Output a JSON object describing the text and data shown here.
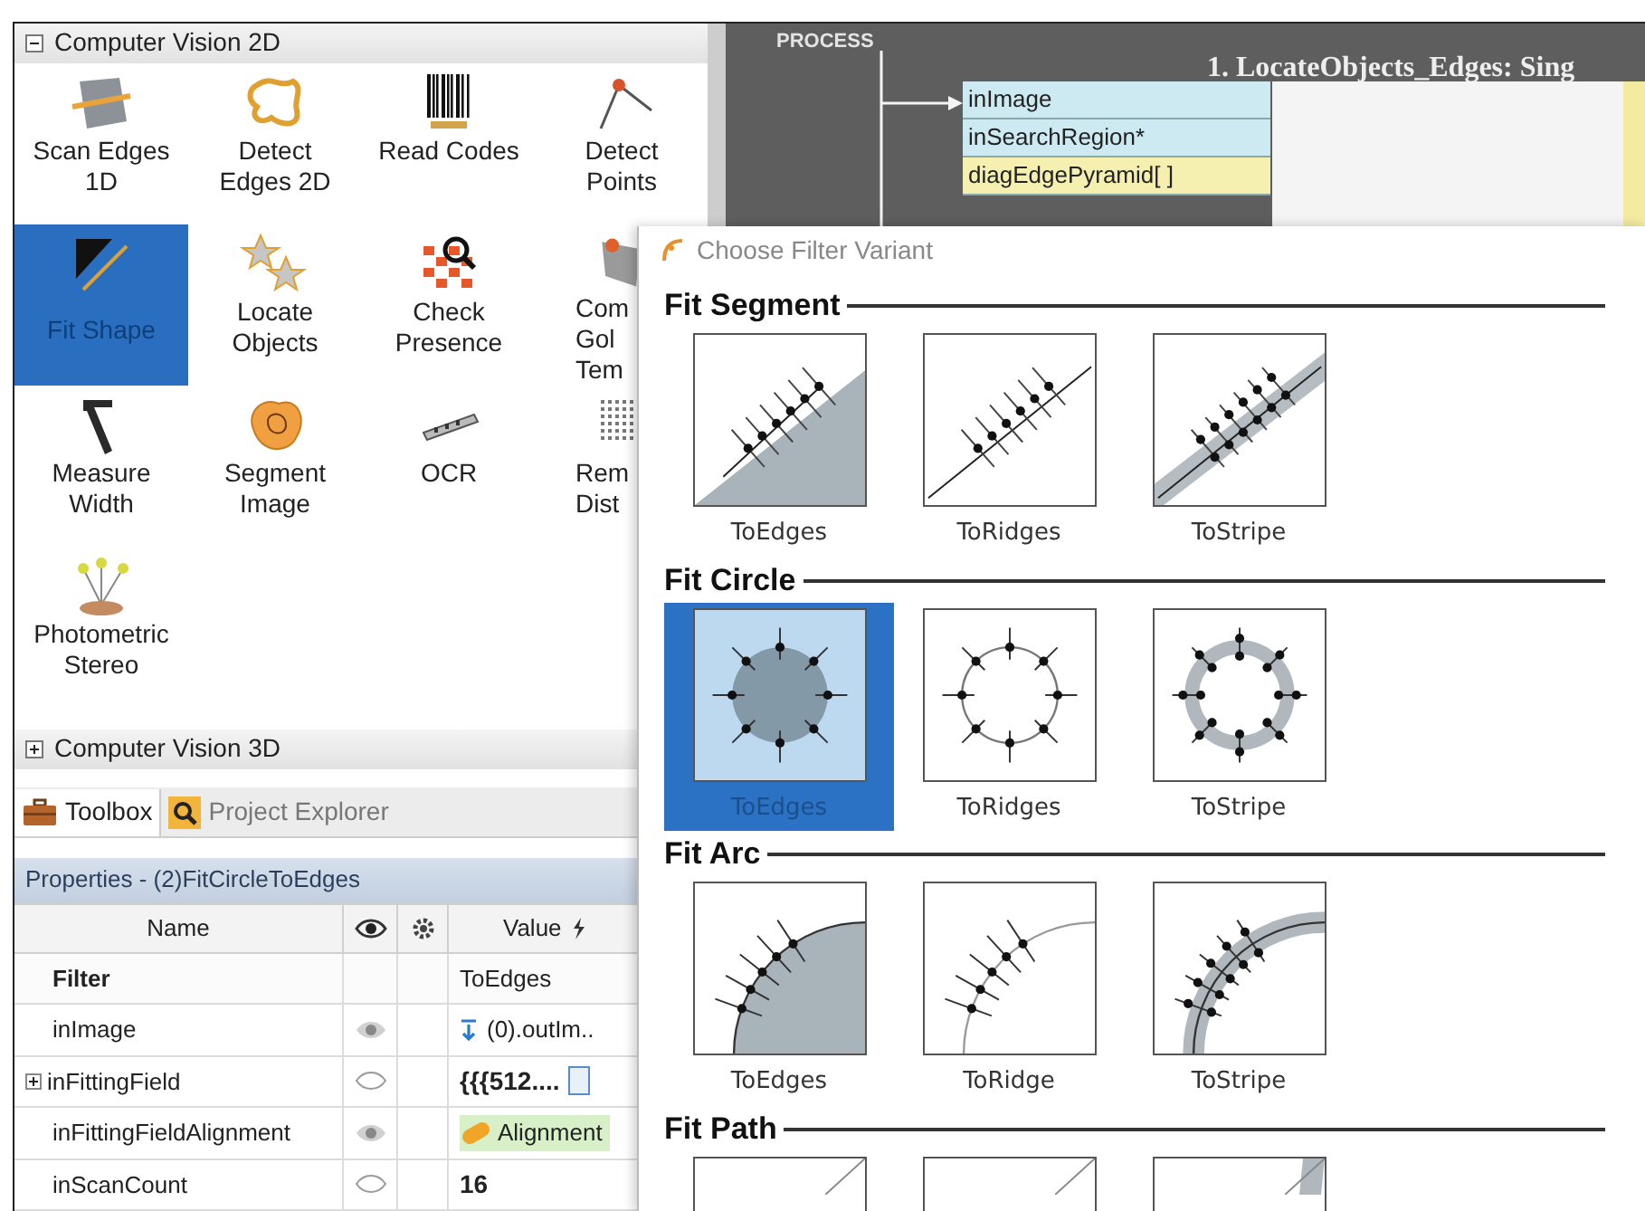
{
  "toolbox": {
    "groups": [
      {
        "label": "Computer Vision 2D",
        "expanded": true
      },
      {
        "label": "Computer Vision 3D",
        "expanded": false
      }
    ],
    "tools": [
      {
        "lines": [
          "Scan Edges",
          "1D"
        ],
        "selected": false
      },
      {
        "lines": [
          "Detect",
          "Edges 2D"
        ],
        "selected": false
      },
      {
        "lines": [
          "Read Codes"
        ],
        "selected": false
      },
      {
        "lines": [
          "Detect",
          "Points"
        ],
        "selected": false
      },
      {
        "lines": [
          "Fit Shape"
        ],
        "selected": true
      },
      {
        "lines": [
          "Locate",
          "Objects"
        ],
        "selected": false
      },
      {
        "lines": [
          "Check",
          "Presence"
        ],
        "selected": false
      },
      {
        "lines": [
          "Com",
          "Gol",
          "Tem"
        ],
        "selected": false
      },
      {
        "lines": [
          "Measure",
          "Width"
        ],
        "selected": false
      },
      {
        "lines": [
          "Segment",
          "Image"
        ],
        "selected": false
      },
      {
        "lines": [
          "OCR"
        ],
        "selected": false
      },
      {
        "lines": [
          "Rem",
          "Dist"
        ],
        "selected": false
      },
      {
        "lines": [
          "Photometric",
          "Stereo"
        ],
        "selected": false
      }
    ]
  },
  "panel_tabs": [
    {
      "label": "Toolbox",
      "selected": true
    },
    {
      "label": "Project Explorer",
      "selected": false
    }
  ],
  "properties": {
    "title": "Properties - (2)FitCircleToEdges",
    "columns": [
      "Name",
      "Value"
    ],
    "rows": [
      {
        "name": "Filter",
        "kind": "header",
        "value": "ToEdges",
        "expandable": false
      },
      {
        "name": "inImage",
        "kind": "link",
        "visible": true,
        "value": "(0).outIm..",
        "expandable": false
      },
      {
        "name": "inFittingField",
        "kind": "edit",
        "visible": false,
        "value": "{{{512....",
        "expandable": true
      },
      {
        "name": "inFittingFieldAlignment",
        "kind": "alignment",
        "visible": true,
        "value": "Alignment",
        "expandable": false
      },
      {
        "name": "inScanCount",
        "kind": "constant",
        "visible": false,
        "value": "16",
        "expandable": false
      }
    ]
  },
  "diagram": {
    "section": "PROCESS",
    "title": "1. LocateObjects_Edges: Sing",
    "ports": [
      {
        "label": "inImage",
        "kind": "input"
      },
      {
        "label": "inSearchRegion*",
        "kind": "input"
      },
      {
        "label": "diagEdgePyramid[ ]",
        "kind": "diagnostic"
      }
    ]
  },
  "dialog": {
    "title": "Choose Filter Variant",
    "sections": [
      {
        "title": "Fit Segment",
        "kind": "segment",
        "items": [
          {
            "label": "ToEdges",
            "kind": "edges",
            "selected": false
          },
          {
            "label": "ToRidges",
            "kind": "ridges",
            "selected": false
          },
          {
            "label": "ToStripe",
            "kind": "stripe",
            "selected": false
          }
        ]
      },
      {
        "title": "Fit Circle",
        "kind": "circle",
        "items": [
          {
            "label": "ToEdges",
            "kind": "edges",
            "selected": true
          },
          {
            "label": "ToRidges",
            "kind": "ridges",
            "selected": false
          },
          {
            "label": "ToStripe",
            "kind": "stripe",
            "selected": false
          }
        ]
      },
      {
        "title": "Fit Arc",
        "kind": "arc",
        "items": [
          {
            "label": "ToEdges",
            "kind": "edges",
            "selected": false
          },
          {
            "label": "ToRidge",
            "kind": "ridges",
            "selected": false
          },
          {
            "label": "ToStripe",
            "kind": "stripe",
            "selected": false
          }
        ]
      },
      {
        "title": "Fit Path",
        "kind": "path",
        "items": [
          {
            "kind": "edges",
            "selected": false
          },
          {
            "kind": "ridges",
            "selected": false
          },
          {
            "kind": "stripe",
            "selected": false
          }
        ]
      }
    ]
  }
}
